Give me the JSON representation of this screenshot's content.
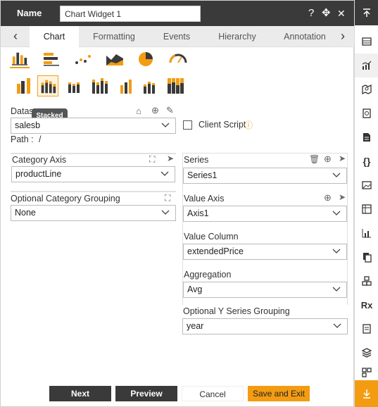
{
  "titlebar": {
    "label": "Name",
    "widget_name": "Chart Widget 1",
    "help_icon": "?",
    "move_icon": "✥",
    "close_icon": "✕"
  },
  "tabs": [
    {
      "label": "Chart",
      "active": true
    },
    {
      "label": "Formatting",
      "active": false
    },
    {
      "label": "Events",
      "active": false
    },
    {
      "label": "Hierarchy",
      "active": false
    },
    {
      "label": "Annotation",
      "active": false
    }
  ],
  "chart_types": [
    "column-chart-icon",
    "bar-chart-icon",
    "scatter-chart-icon",
    "area-chart-icon",
    "pie-chart-icon",
    "gauge-chart-icon"
  ],
  "chart_subtypes": [
    "clustered-column-icon",
    "stacked-column-icon",
    "small-stacked-icon",
    "multi-column-icon",
    "compact-column-icon",
    "mini-stacked-icon",
    "full-stacked-icon"
  ],
  "tooltip": "Stacked",
  "dataset": {
    "label": "Datas",
    "value": "salesb",
    "path_label": "Path :",
    "path_value": "/"
  },
  "client_script": {
    "label": "Client Script",
    "info_icon": "ⓘ"
  },
  "category_axis": {
    "label": "Category Axis",
    "value": "productLine"
  },
  "optional_category_grouping": {
    "label": "Optional Category Grouping",
    "value": "None"
  },
  "series": {
    "label": "Series",
    "value": "Series1"
  },
  "value_axis": {
    "label": "Value Axis",
    "value": "Axis1"
  },
  "value_column": {
    "label": "Value Column",
    "value": "extendedPrice"
  },
  "aggregation": {
    "label": "Aggregation",
    "value": "Avg"
  },
  "optional_y_series_grouping": {
    "label": "Optional Y Series Grouping",
    "value": "year"
  },
  "buttons": {
    "next": "Next",
    "preview": "Preview",
    "cancel": "Cancel",
    "save_exit": "Save and Exit"
  },
  "sidebar_icons": [
    "collapse-top-icon",
    "table-icon",
    "chart-icon",
    "map-icon",
    "report-icon",
    "document-icon",
    "script-braces-icon",
    "image-icon",
    "pivot-icon",
    "kpi-chart-icon",
    "copy-icon",
    "cubes-icon",
    "rx-icon",
    "form-icon",
    "layers-icon",
    "grid-icon",
    "download-icon"
  ],
  "sidebar_rx": "Rx",
  "sidebar_braces": "{}",
  "colors": {
    "accent": "#f39c12",
    "dark": "#3a3a3a",
    "chart_dark": "#3a3a3a"
  }
}
